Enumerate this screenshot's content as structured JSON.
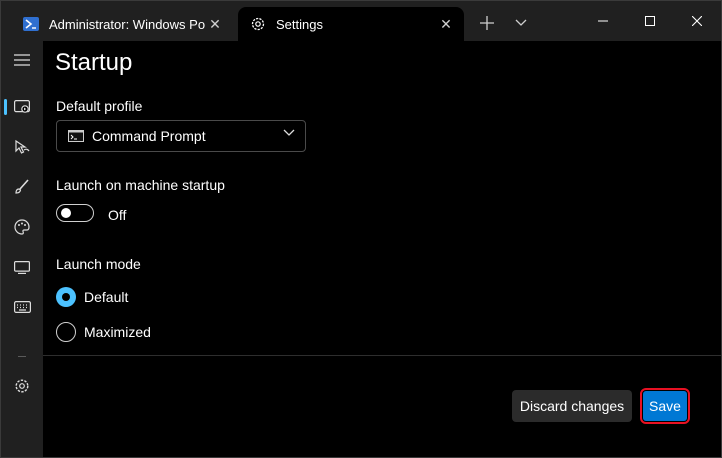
{
  "window": {
    "tabs": [
      {
        "title": "Administrator: Windows Pow",
        "icon": "powershell-icon"
      },
      {
        "title": "Settings",
        "icon": "gear-icon"
      }
    ],
    "new_tab_icon": "plus-icon",
    "tab_dropdown_icon": "chevron-down-icon",
    "captions": [
      "minimize-icon",
      "maximize-icon",
      "close-icon"
    ]
  },
  "nav": {
    "items": [
      {
        "icon": "menu-icon"
      },
      {
        "icon": "startup-icon",
        "selected": true
      },
      {
        "icon": "interaction-icon"
      },
      {
        "icon": "appearance-brush-icon"
      },
      {
        "icon": "color-schemes-palette-icon"
      },
      {
        "icon": "rendering-monitor-icon"
      },
      {
        "icon": "actions-keyboard-icon"
      },
      {
        "icon": "open-json-gear-icon"
      }
    ]
  },
  "page": {
    "title": "Startup",
    "default_profile": {
      "label": "Default profile",
      "value": "Command Prompt",
      "icon": "cmd-icon"
    },
    "launch_on_startup": {
      "label": "Launch on machine startup",
      "state": "Off"
    },
    "launch_mode": {
      "label": "Launch mode",
      "options": [
        {
          "label": "Default",
          "selected": true
        },
        {
          "label": "Maximized",
          "selected": false
        }
      ]
    }
  },
  "footer": {
    "discard_label": "Discard changes",
    "save_label": "Save"
  },
  "colors": {
    "accent": "#4cc2ff",
    "save_button": "#0078d4",
    "highlight": "#e81123"
  }
}
